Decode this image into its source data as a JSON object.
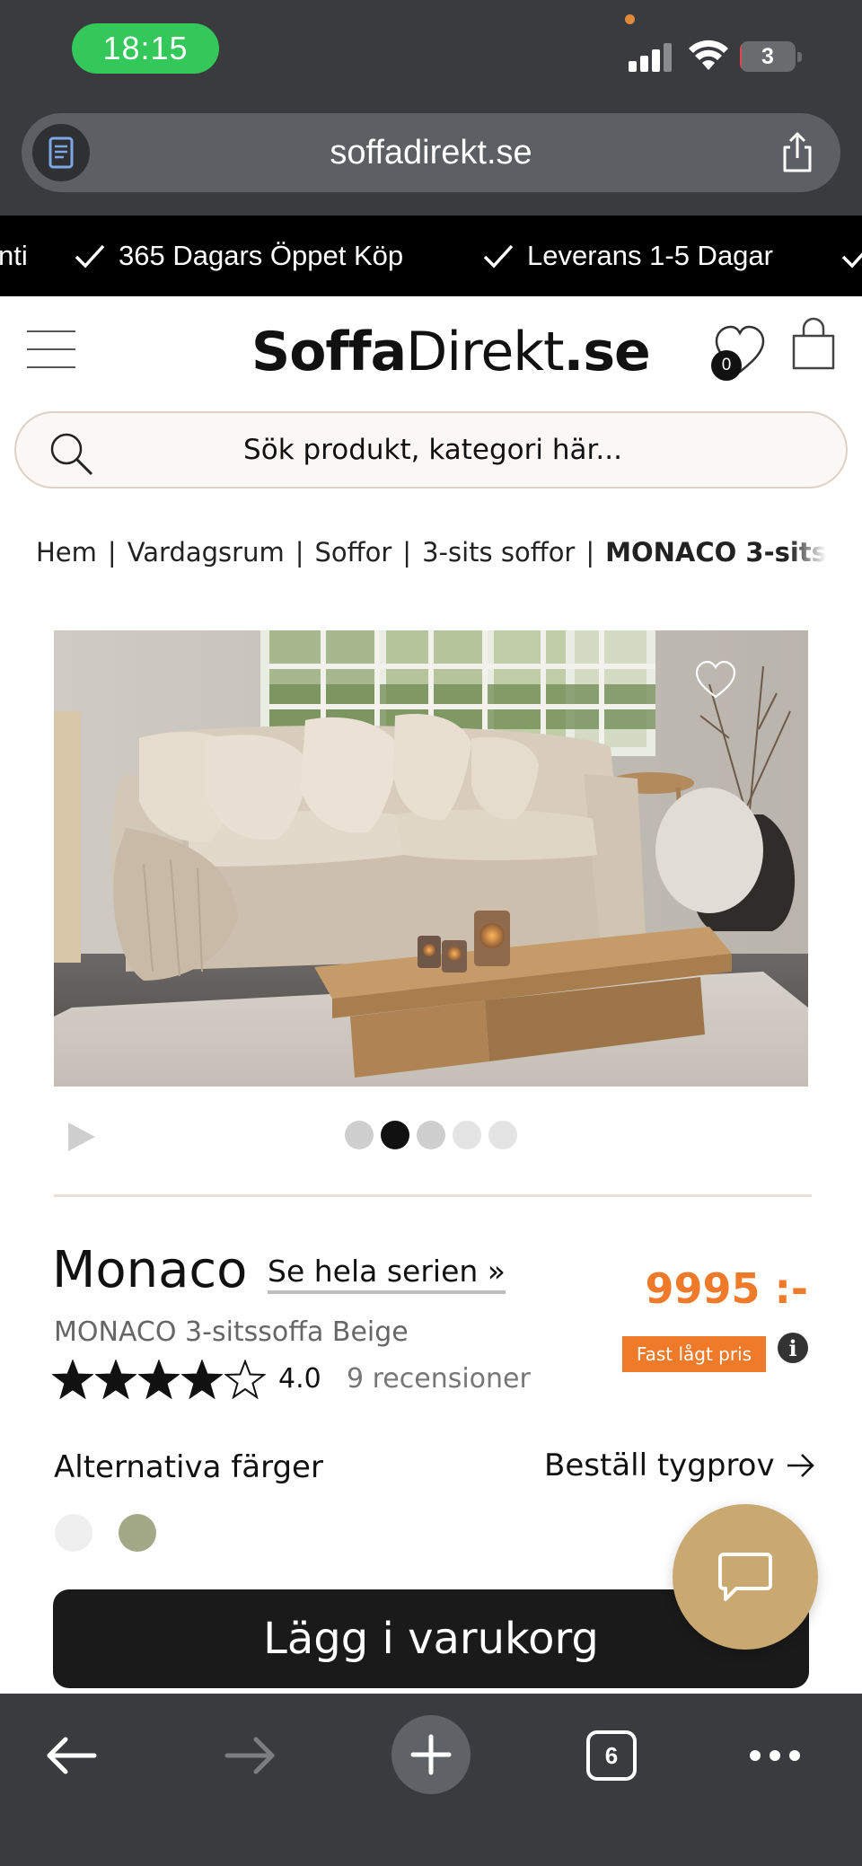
{
  "status_bar": {
    "time": "18:15",
    "battery_level": "3",
    "battery_fraction": 0.03,
    "battery_color": "#e0454a",
    "time_pill_color": "#34c759"
  },
  "browser": {
    "url": "soffadirekt.se",
    "reader_icon": "reader-icon",
    "share_icon": "share-icon",
    "open_tabs_count": "6"
  },
  "promo_ticker": {
    "items": [
      "nti",
      "365 Dagars Öppet Köp",
      "Leverans 1-5 Dagar"
    ]
  },
  "header": {
    "logo_part1": "Soffa",
    "logo_part2": "Direkt",
    "logo_part3": ".se",
    "wishlist_count": "0",
    "search_placeholder": "Sök produkt, kategori här..."
  },
  "breadcrumb": {
    "items": [
      "Hem",
      "Vardagsrum",
      "Soffor",
      "3-sits soffor"
    ],
    "current": "MONACO 3-sitss",
    "separator": "|"
  },
  "gallery": {
    "active_index": 1,
    "total_images": 5
  },
  "product": {
    "name": "Monaco",
    "series_link": "Se hela serien »",
    "subtitle": "MONACO 3-sitssoffa Beige",
    "rating": "4.0",
    "rating_value": 4,
    "rating_max": 5,
    "reviews": "9 recensioner",
    "price": "9995 :-",
    "price_badge": "Fast lågt pris",
    "price_color": "#ef7a2a"
  },
  "colors_section": {
    "label": "Alternativa färger",
    "fabric_sample_link": "Beställ tygprov",
    "swatches": [
      "#efefef",
      "#a3a887"
    ]
  },
  "cta": {
    "add_to_cart": "Lägg i varukorg"
  },
  "accent": {
    "chat_button": "#c9a971"
  }
}
